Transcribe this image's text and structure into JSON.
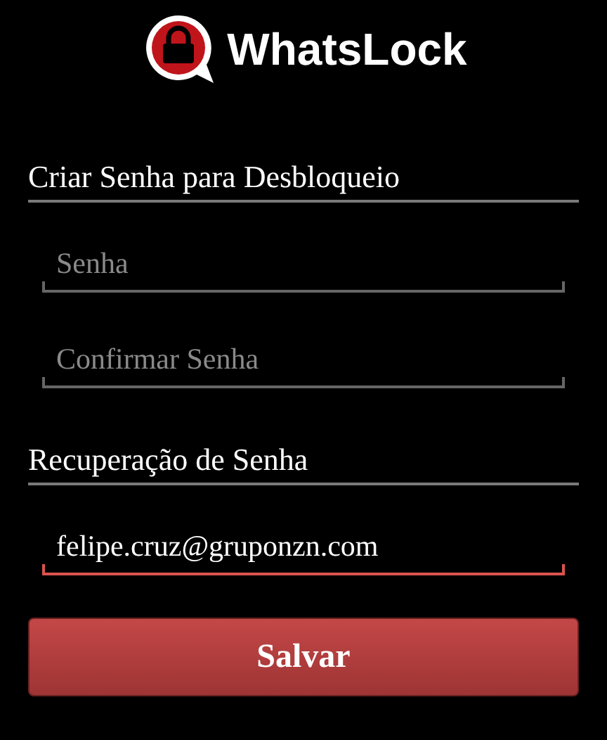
{
  "app": {
    "title": "WhatsLock"
  },
  "sections": [
    {
      "heading": "Criar Senha para Desbloqueio",
      "fields": [
        {
          "placeholder": "Senha",
          "focused": false
        },
        {
          "placeholder": "Confirmar Senha",
          "focused": false
        }
      ]
    },
    {
      "heading": "Recuperação de Senha",
      "fields": [
        {
          "value": "felipe.cruz@gruponzn.com",
          "focused": true
        }
      ]
    }
  ],
  "buttons": [
    "Salvar"
  ]
}
